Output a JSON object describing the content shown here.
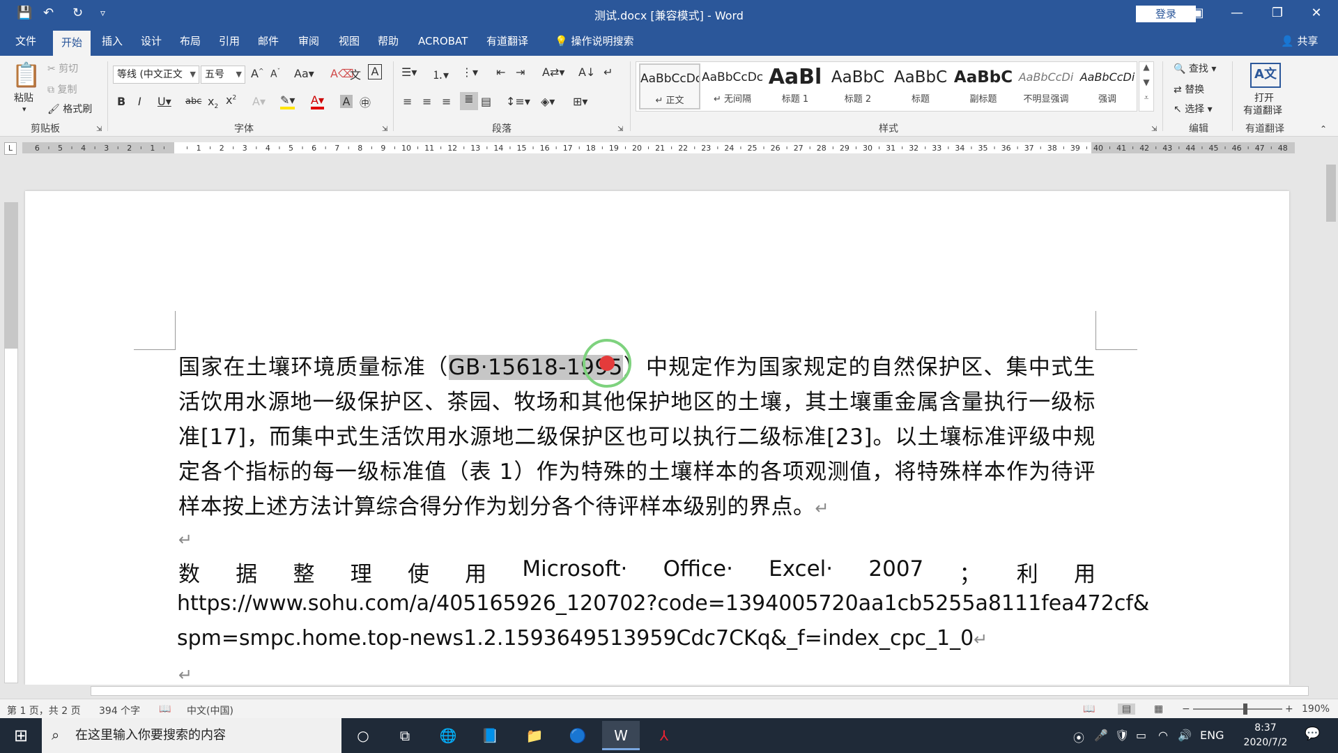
{
  "titlebar": {
    "title": "测试.docx [兼容模式] - Word",
    "login": "登录",
    "qat": {
      "save": "💾",
      "undo": "↶",
      "redo": "↻",
      "customize": "▿"
    }
  },
  "tabs": [
    "文件",
    "开始",
    "插入",
    "设计",
    "布局",
    "引用",
    "邮件",
    "审阅",
    "视图",
    "帮助",
    "ACROBAT",
    "有道翻译"
  ],
  "tell_me": "操作说明搜索",
  "share": "共享",
  "ribbon": {
    "clipboard": {
      "paste": "粘贴",
      "cut": "剪切",
      "copy": "复制",
      "format_painter": "格式刷",
      "label": "剪贴板"
    },
    "font": {
      "font_name": "等线 (中文正文",
      "font_size": "五号",
      "label": "字体"
    },
    "paragraph": {
      "label": "段落"
    },
    "styles": {
      "label": "样式",
      "items": [
        {
          "preview": "AaBbCcDc",
          "name": "↵ 正文"
        },
        {
          "preview": "AaBbCcDc",
          "name": "↵ 无间隔"
        },
        {
          "preview": "AaBl",
          "name": "标题 1"
        },
        {
          "preview": "AaBbC",
          "name": "标题 2"
        },
        {
          "preview": "AaBbC",
          "name": "标题"
        },
        {
          "preview": "AaBbC",
          "name": "副标题"
        },
        {
          "preview": "AaBbCcDi",
          "name": "不明显强调"
        },
        {
          "preview": "AaBbCcDi",
          "name": "强调"
        }
      ]
    },
    "editing": {
      "find": "查找",
      "replace": "替换",
      "select": "选择",
      "label": "编辑"
    },
    "youdao": {
      "open": "打开",
      "translate": "有道翻译",
      "label": "有道翻译"
    }
  },
  "ruler_corner": "L",
  "document": {
    "para1_before": "国家在土壤环境质量标准（",
    "para1_highlight": "GB·15618-1995",
    "para1_after": "）中规定作为国家规定的自然保护区、集中式生活饮用水源地一级保护区、茶园、牧场和其他保护地区的土壤，其土壤重金属含量执行一级标准[17]，而集中式生活饮用水源地二级保护区也可以执行二级标准[23]。以土壤标准评级中规定各个指标的每一级标准值（表 1）作为特殊的土壤样本的各项观测值，将特殊样本作为待评样本按上述方法计算综合得分作为划分各个待评样本级别的界点。",
    "para_mark": "↵",
    "para2_words": [
      "数",
      "据",
      "整",
      "理",
      "使",
      "用",
      "Microsoft·",
      "Office·",
      "Excel·",
      "2007",
      "；",
      "利",
      "用"
    ],
    "para2_line2": "https://www.sohu.com/a/405165926_120702?code=1394005720aa1cb5255a8111fea472cf&",
    "para2_line3": "spm=smpc.home.top-news1.2.1593649513959Cdc7CKq&_f=index_cpc_1_0"
  },
  "statusbar": {
    "page": "第 1 页，共 2 页",
    "words": "394 个字",
    "language": "中文(中国)",
    "zoom": "190%"
  },
  "taskbar": {
    "search_placeholder": "在这里输入你要搜索的内容",
    "ime": "ENG",
    "time": "8:37",
    "date": "2020/7/2"
  }
}
